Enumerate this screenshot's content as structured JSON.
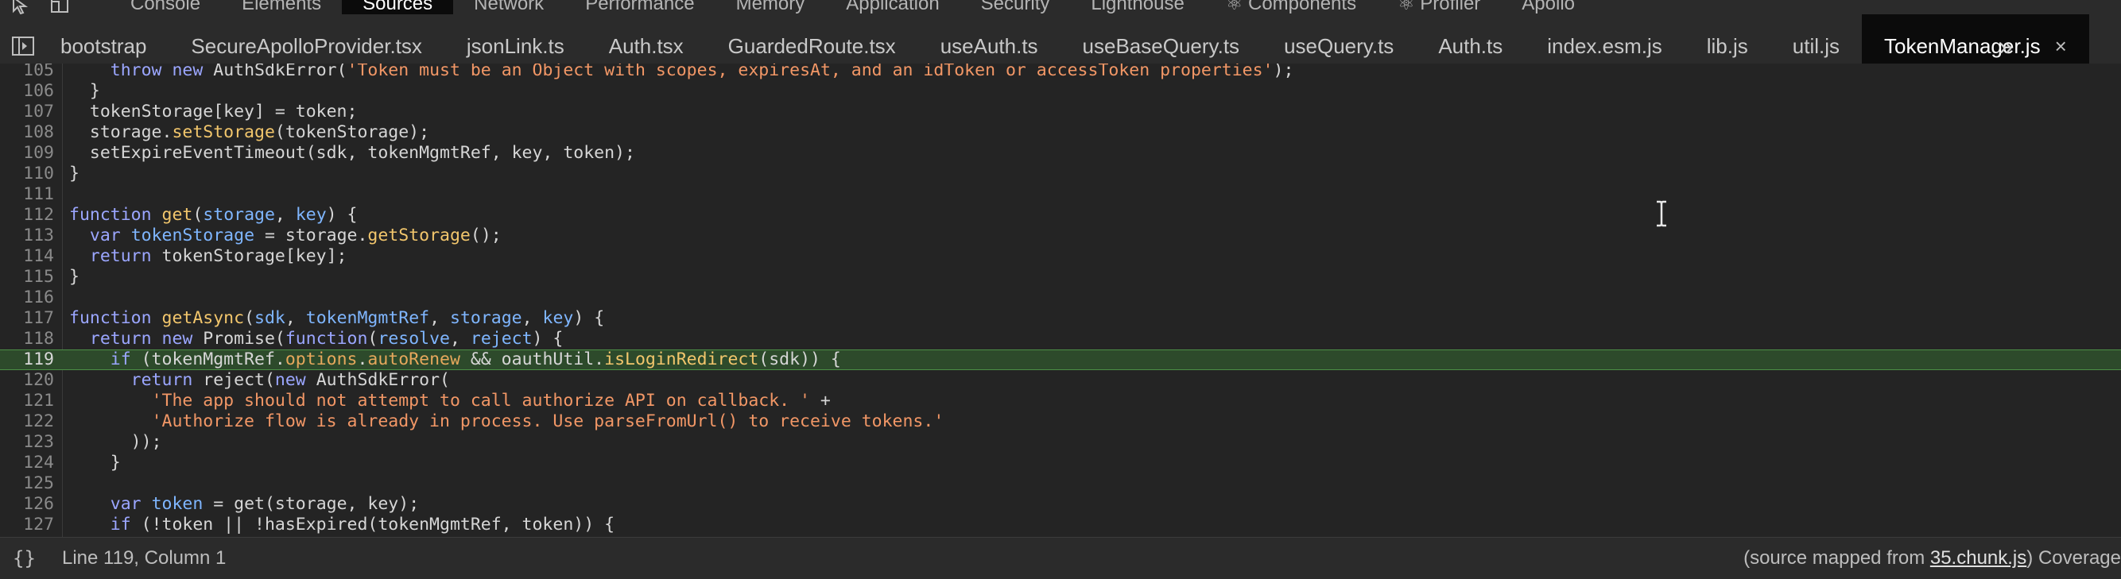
{
  "panel_tabs": [
    {
      "label": "Console",
      "active": false
    },
    {
      "label": "Elements",
      "active": false
    },
    {
      "label": "Sources",
      "active": true
    },
    {
      "label": "Network",
      "active": false
    },
    {
      "label": "Performance",
      "active": false
    },
    {
      "label": "Memory",
      "active": false
    },
    {
      "label": "Application",
      "active": false
    },
    {
      "label": "Security",
      "active": false
    },
    {
      "label": "Lighthouse",
      "active": false
    },
    {
      "label": "⚛ Components",
      "active": false
    },
    {
      "label": "⚛ Profiler",
      "active": false
    },
    {
      "label": "Apollo",
      "active": false
    }
  ],
  "file_tabs": [
    {
      "label": "bootstrap",
      "active": false
    },
    {
      "label": "SecureApolloProvider.tsx",
      "active": false
    },
    {
      "label": "jsonLink.ts",
      "active": false
    },
    {
      "label": "Auth.tsx",
      "active": false
    },
    {
      "label": "GuardedRoute.tsx",
      "active": false
    },
    {
      "label": "useAuth.ts",
      "active": false
    },
    {
      "label": "useBaseQuery.ts",
      "active": false
    },
    {
      "label": "useQuery.ts",
      "active": false
    },
    {
      "label": "Auth.ts",
      "active": false
    },
    {
      "label": "index.esm.js",
      "active": false
    },
    {
      "label": "lib.js",
      "active": false
    },
    {
      "label": "util.js",
      "active": false
    },
    {
      "label": "TokenManager.js",
      "active": true
    }
  ],
  "file_tab_close": "×",
  "more_tabs": "»",
  "code": {
    "current_line": 119,
    "lines": [
      {
        "n": "105",
        "segs": [
          [
            "",
            "    "
          ],
          [
            "kw",
            "throw"
          ],
          [
            "",
            " "
          ],
          [
            "kw",
            "new"
          ],
          [
            "",
            " AuthSdkError("
          ],
          [
            "str",
            "'Token must be an Object with scopes, expiresAt, and an idToken or accessToken properties'"
          ],
          [
            "",
            ");"
          ]
        ]
      },
      {
        "n": "106",
        "segs": [
          [
            "",
            "  }"
          ]
        ]
      },
      {
        "n": "107",
        "segs": [
          [
            "",
            "  tokenStorage[key] = token;"
          ]
        ]
      },
      {
        "n": "108",
        "segs": [
          [
            "",
            "  storage."
          ],
          [
            "fn",
            "setStorage"
          ],
          [
            "",
            "(tokenStorage);"
          ]
        ]
      },
      {
        "n": "109",
        "segs": [
          [
            "",
            "  setExpireEventTimeout(sdk, tokenMgmtRef, key, token);"
          ]
        ]
      },
      {
        "n": "110",
        "segs": [
          [
            "",
            "}"
          ]
        ]
      },
      {
        "n": "111",
        "segs": []
      },
      {
        "n": "112",
        "segs": [
          [
            "kw",
            "function"
          ],
          [
            "",
            " "
          ],
          [
            "fn",
            "get"
          ],
          [
            "",
            "("
          ],
          [
            "var",
            "storage"
          ],
          [
            "",
            ", "
          ],
          [
            "var",
            "key"
          ],
          [
            "",
            ") {"
          ]
        ]
      },
      {
        "n": "113",
        "segs": [
          [
            "",
            "  "
          ],
          [
            "kw",
            "var"
          ],
          [
            "",
            " "
          ],
          [
            "var",
            "tokenStorage"
          ],
          [
            "",
            " = storage."
          ],
          [
            "fn",
            "getStorage"
          ],
          [
            "",
            "();"
          ]
        ]
      },
      {
        "n": "114",
        "segs": [
          [
            "",
            "  "
          ],
          [
            "kw",
            "return"
          ],
          [
            "",
            " tokenStorage[key];"
          ]
        ]
      },
      {
        "n": "115",
        "segs": [
          [
            "",
            "}"
          ]
        ]
      },
      {
        "n": "116",
        "segs": []
      },
      {
        "n": "117",
        "segs": [
          [
            "kw",
            "function"
          ],
          [
            "",
            " "
          ],
          [
            "fn",
            "getAsync"
          ],
          [
            "",
            "("
          ],
          [
            "var",
            "sdk"
          ],
          [
            "",
            ", "
          ],
          [
            "var",
            "tokenMgmtRef"
          ],
          [
            "",
            ", "
          ],
          [
            "var",
            "storage"
          ],
          [
            "",
            ", "
          ],
          [
            "var",
            "key"
          ],
          [
            "",
            ") {"
          ]
        ]
      },
      {
        "n": "118",
        "segs": [
          [
            "",
            "  "
          ],
          [
            "kw",
            "return"
          ],
          [
            "",
            " "
          ],
          [
            "kw",
            "new"
          ],
          [
            "",
            " Promise("
          ],
          [
            "kw",
            "function"
          ],
          [
            "",
            "("
          ],
          [
            "var",
            "resolve"
          ],
          [
            "",
            ", "
          ],
          [
            "var",
            "reject"
          ],
          [
            "",
            ") {"
          ]
        ]
      },
      {
        "n": "119",
        "segs": [
          [
            "",
            "    "
          ],
          [
            "kw",
            "if"
          ],
          [
            "",
            " (tokenMgmtRef."
          ],
          [
            "prop",
            "options"
          ],
          [
            "",
            "."
          ],
          [
            "prop",
            "autoRenew"
          ],
          [
            "",
            " && oauthUtil."
          ],
          [
            "fn",
            "isLoginRedirect"
          ],
          [
            "",
            "(sdk)) {"
          ]
        ]
      },
      {
        "n": "120",
        "segs": [
          [
            "",
            "      "
          ],
          [
            "kw",
            "return"
          ],
          [
            "",
            " reject("
          ],
          [
            "kw",
            "new"
          ],
          [
            "",
            " AuthSdkError("
          ]
        ]
      },
      {
        "n": "121",
        "segs": [
          [
            "",
            "        "
          ],
          [
            "str",
            "'The app should not attempt to call authorize API on callback. '"
          ],
          [
            "",
            " +"
          ]
        ]
      },
      {
        "n": "122",
        "segs": [
          [
            "",
            "        "
          ],
          [
            "str",
            "'Authorize flow is already in process. Use parseFromUrl() to receive tokens.'"
          ]
        ]
      },
      {
        "n": "123",
        "segs": [
          [
            "",
            "      ));"
          ]
        ]
      },
      {
        "n": "124",
        "segs": [
          [
            "",
            "    }"
          ]
        ]
      },
      {
        "n": "125",
        "segs": []
      },
      {
        "n": "126",
        "segs": [
          [
            "",
            "    "
          ],
          [
            "kw",
            "var"
          ],
          [
            "",
            " "
          ],
          [
            "var",
            "token"
          ],
          [
            "",
            " = get(storage, key);"
          ]
        ]
      },
      {
        "n": "127",
        "segs": [
          [
            "",
            "    "
          ],
          [
            "kw",
            "if"
          ],
          [
            "",
            " (!token || !hasExpired(tokenMgmtRef, token)) {"
          ]
        ]
      }
    ]
  },
  "status": {
    "pretty_print": "{}",
    "position": "Line 119, Column 1",
    "mapped_prefix": "(source mapped from ",
    "mapped_link": "35.chunk.js",
    "mapped_suffix": ")",
    "coverage": "Coverage"
  },
  "colors": {
    "execution_line_bg": "#2d4a2b",
    "keyword": "#9ba6ff",
    "string": "#f29766",
    "function": "#f2c66c"
  }
}
